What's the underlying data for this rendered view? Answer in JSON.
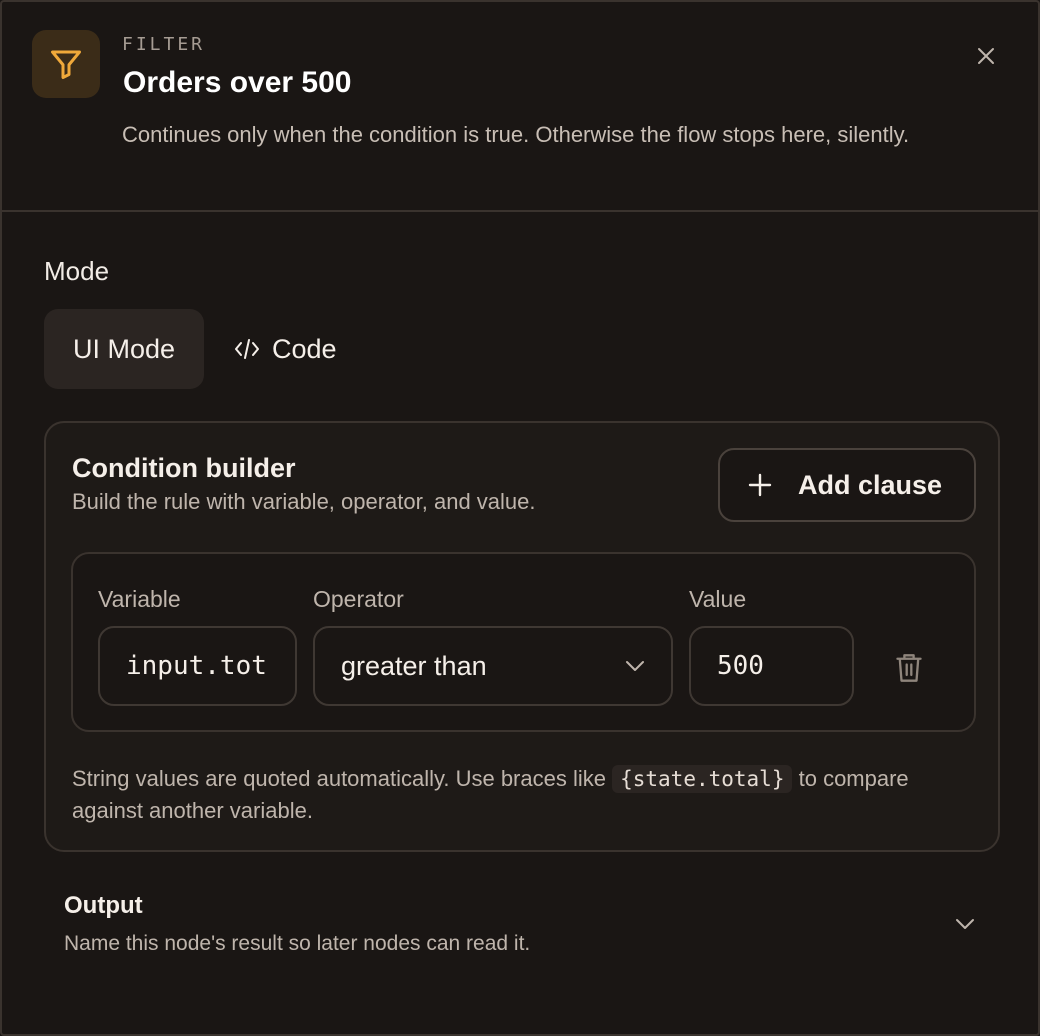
{
  "header": {
    "icon": "filter-icon",
    "eyebrow": "FILTER",
    "title": "Orders over 500",
    "description": "Continues only when the condition is true. Otherwise the flow stops here, silently.",
    "close_icon": "close-icon"
  },
  "mode": {
    "label": "Mode",
    "tabs": [
      {
        "label": "UI Mode",
        "active": true
      },
      {
        "label": "Code",
        "icon": "code-icon",
        "active": false
      }
    ]
  },
  "condition_builder": {
    "title": "Condition builder",
    "subtitle": "Build the rule with variable, operator, and value.",
    "add_clause_label": "Add clause",
    "clause": {
      "variable_label": "Variable",
      "variable_value": "input.tot",
      "operator_label": "Operator",
      "operator_value": "greater than",
      "value_label": "Value",
      "value_value": "500"
    },
    "hint_before": "String values are quoted automatically. Use braces like",
    "hint_code": "{state.total}",
    "hint_after": "to compare against another variable."
  },
  "output": {
    "title": "Output",
    "subtitle": "Name this node's result so later nodes can read it."
  },
  "colors": {
    "background": "#1a1614",
    "accent": "#f0a93a",
    "border": "#3a332e"
  }
}
